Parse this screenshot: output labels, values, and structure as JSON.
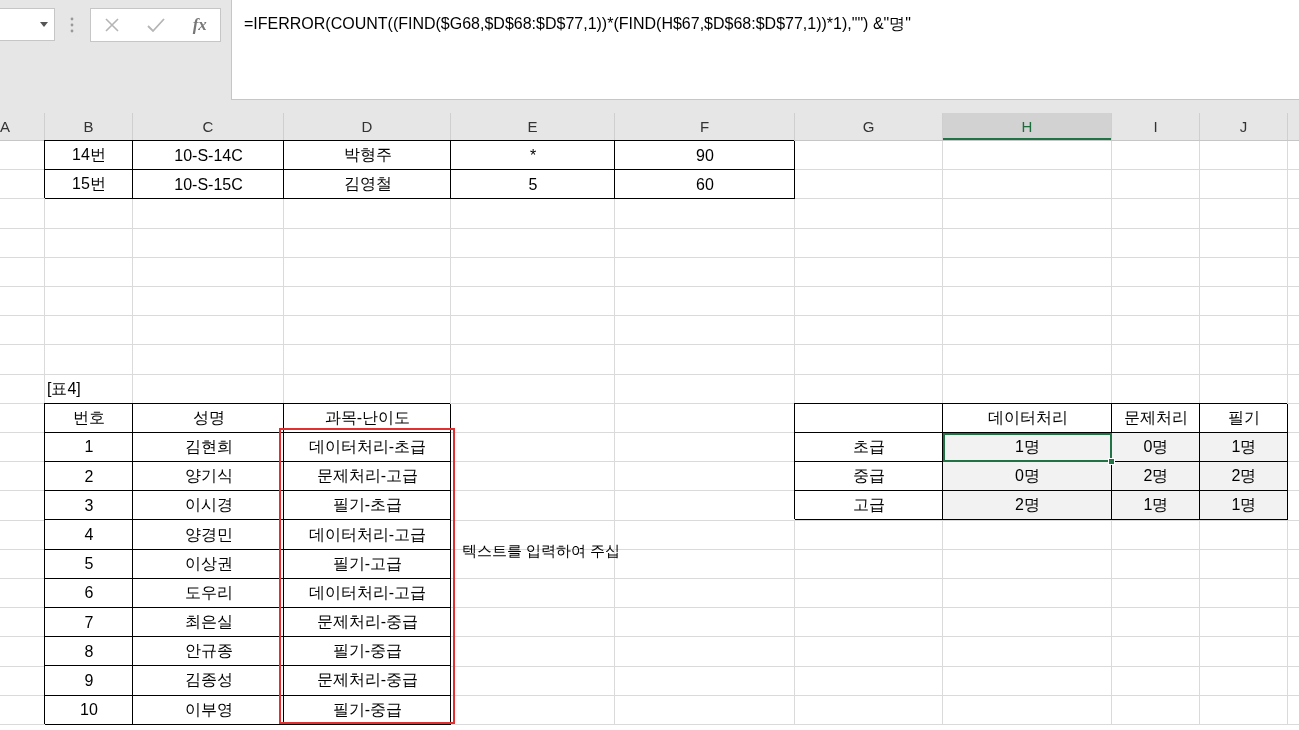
{
  "formula_bar": {
    "function_label": "fx",
    "formula": "=IFERROR(COUNT((FIND($G68,$D$68:$D$77,1))*(FIND(H$67,$D$68:$D$77,1))*1),\"\") &\"명\""
  },
  "columns": [
    {
      "label": "A",
      "selected": false
    },
    {
      "label": "B",
      "selected": false
    },
    {
      "label": "C",
      "selected": false
    },
    {
      "label": "D",
      "selected": false
    },
    {
      "label": "E",
      "selected": false
    },
    {
      "label": "F",
      "selected": false
    },
    {
      "label": "G",
      "selected": false
    },
    {
      "label": "H",
      "selected": true
    },
    {
      "label": "I",
      "selected": false
    },
    {
      "label": "J",
      "selected": false
    }
  ],
  "score_table": {
    "rows": [
      [
        "14번",
        "10-S-14C",
        "박형주",
        "*",
        "90"
      ],
      [
        "15번",
        "10-S-15C",
        "김영철",
        "5",
        "60"
      ]
    ]
  },
  "table4": {
    "caption": "[표4]",
    "columns": [
      "번호",
      "성명",
      "과목-난이도"
    ],
    "rows": [
      [
        "1",
        "김현희",
        "데이터처리-초급"
      ],
      [
        "2",
        "양기식",
        "문제처리-고급"
      ],
      [
        "3",
        "이시경",
        "필기-초급"
      ],
      [
        "4",
        "양경민",
        "데이터처리-고급"
      ],
      [
        "5",
        "이상권",
        "필기-고급"
      ],
      [
        "6",
        "도우리",
        "데이터처리-고급"
      ],
      [
        "7",
        "최은실",
        "문제처리-중급"
      ],
      [
        "8",
        "안규종",
        "필기-중급"
      ],
      [
        "9",
        "김종성",
        "문제처리-중급"
      ],
      [
        "10",
        "이부영",
        "필기-중급"
      ]
    ]
  },
  "summary": {
    "columns": [
      "데이터처리",
      "문제처리",
      "필기"
    ],
    "rows": [
      {
        "label": "초급",
        "values": [
          {
            "text": "1명",
            "selected": true
          },
          {
            "text": "0명",
            "selected": false
          },
          {
            "text": "1명",
            "selected": false
          }
        ]
      },
      {
        "label": "중급",
        "values": [
          {
            "text": "0명",
            "selected": false
          },
          {
            "text": "2명",
            "selected": false
          },
          {
            "text": "2명",
            "selected": false
          }
        ]
      },
      {
        "label": "고급",
        "values": [
          {
            "text": "2명",
            "selected": false
          },
          {
            "text": "1명",
            "selected": false
          },
          {
            "text": "1명",
            "selected": false
          }
        ]
      }
    ]
  },
  "text_box": {
    "text": "텍스트를 입력하여 주십"
  }
}
